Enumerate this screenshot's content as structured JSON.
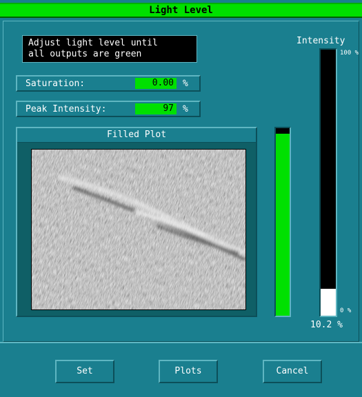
{
  "window": {
    "title": "Light Level"
  },
  "message": "Adjust light level until\nall outputs are green",
  "saturation": {
    "label": "Saturation:",
    "value": "0.00",
    "unit": "%"
  },
  "peak": {
    "label": "Peak Intensity:",
    "value": "97",
    "unit": "%"
  },
  "plot": {
    "title": "Filled Plot"
  },
  "green_level": 0.97,
  "intensity": {
    "label": "Intensity",
    "top_tick": "100 %",
    "bottom_tick": "0 %",
    "value_text": "10.2 %",
    "level": 0.102
  },
  "buttons": {
    "set": "Set",
    "plots": "Plots",
    "cancel": "Cancel"
  },
  "colors": {
    "background": "#1a7f8f",
    "ok_green": "#00e000",
    "title_green": "#00e000"
  }
}
